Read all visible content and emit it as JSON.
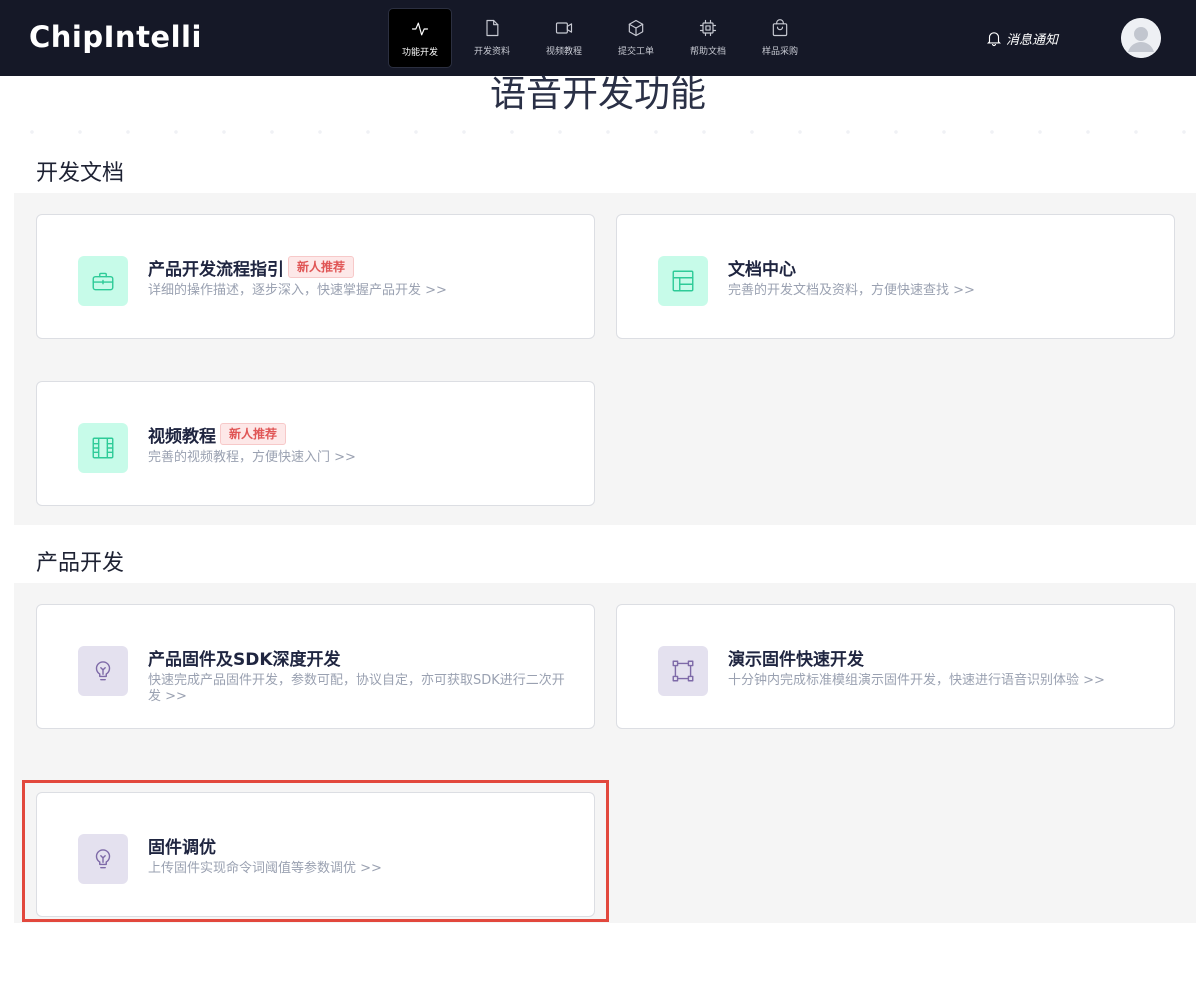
{
  "brand": {
    "logo_text": "ChipIntelli"
  },
  "nav": {
    "items": [
      {
        "label": "功能开发",
        "icon": "activity-icon",
        "active": true
      },
      {
        "label": "开发资料",
        "icon": "document-icon",
        "active": false
      },
      {
        "label": "视频教程",
        "icon": "video-icon",
        "active": false
      },
      {
        "label": "提交工单",
        "icon": "cube-icon",
        "active": false
      },
      {
        "label": "帮助文档",
        "icon": "chip-icon",
        "active": false
      },
      {
        "label": "样品采购",
        "icon": "shopping-bag-icon",
        "active": false
      }
    ]
  },
  "header": {
    "notice_label": "消息通知"
  },
  "page": {
    "title": "语音开发功能"
  },
  "sections": [
    {
      "title": "开发文档",
      "cards": [
        {
          "title": "产品开发流程指引",
          "badge": "新人推荐",
          "desc": "详细的操作描述，逐步深入，快速掌握产品开发 >>",
          "icon": "toolbox-icon",
          "tone": "mint"
        },
        {
          "title": "文档中心",
          "badge": "",
          "desc": "完善的开发文档及资料，方便快速查找 >>",
          "icon": "layout-icon",
          "tone": "mint"
        },
        {
          "title": "视频教程",
          "badge": "新人推荐",
          "desc": "完善的视频教程，方便快速入门 >>",
          "icon": "film-icon",
          "tone": "mint"
        }
      ]
    },
    {
      "title": "产品开发",
      "cards": [
        {
          "title": "产品固件及SDK深度开发",
          "badge": "",
          "desc": "快速完成产品固件开发，参数可配，协议自定，亦可获取SDK进行二次开发 >>",
          "icon": "lightbulb-icon",
          "tone": "lavender"
        },
        {
          "title": "演示固件快速开发",
          "badge": "",
          "desc": "十分钟内完成标准模组演示固件开发，快速进行语音识别体验 >>",
          "icon": "frame-icon",
          "tone": "lavender"
        },
        {
          "title": "固件调优",
          "badge": "",
          "desc": "上传固件实现命令词阈值等参数调优 >>",
          "icon": "lightbulb-icon",
          "tone": "lavender"
        }
      ]
    }
  ],
  "colors": {
    "nav_bg": "#151827",
    "mint_icon_bg": "#c7fbe9",
    "mint_icon": "#2ecb98",
    "lavender_icon_bg": "#e4e1ef",
    "lavender_icon": "#7e6aa8",
    "badge_text": "#e05656",
    "highlight": "#e2483d"
  }
}
